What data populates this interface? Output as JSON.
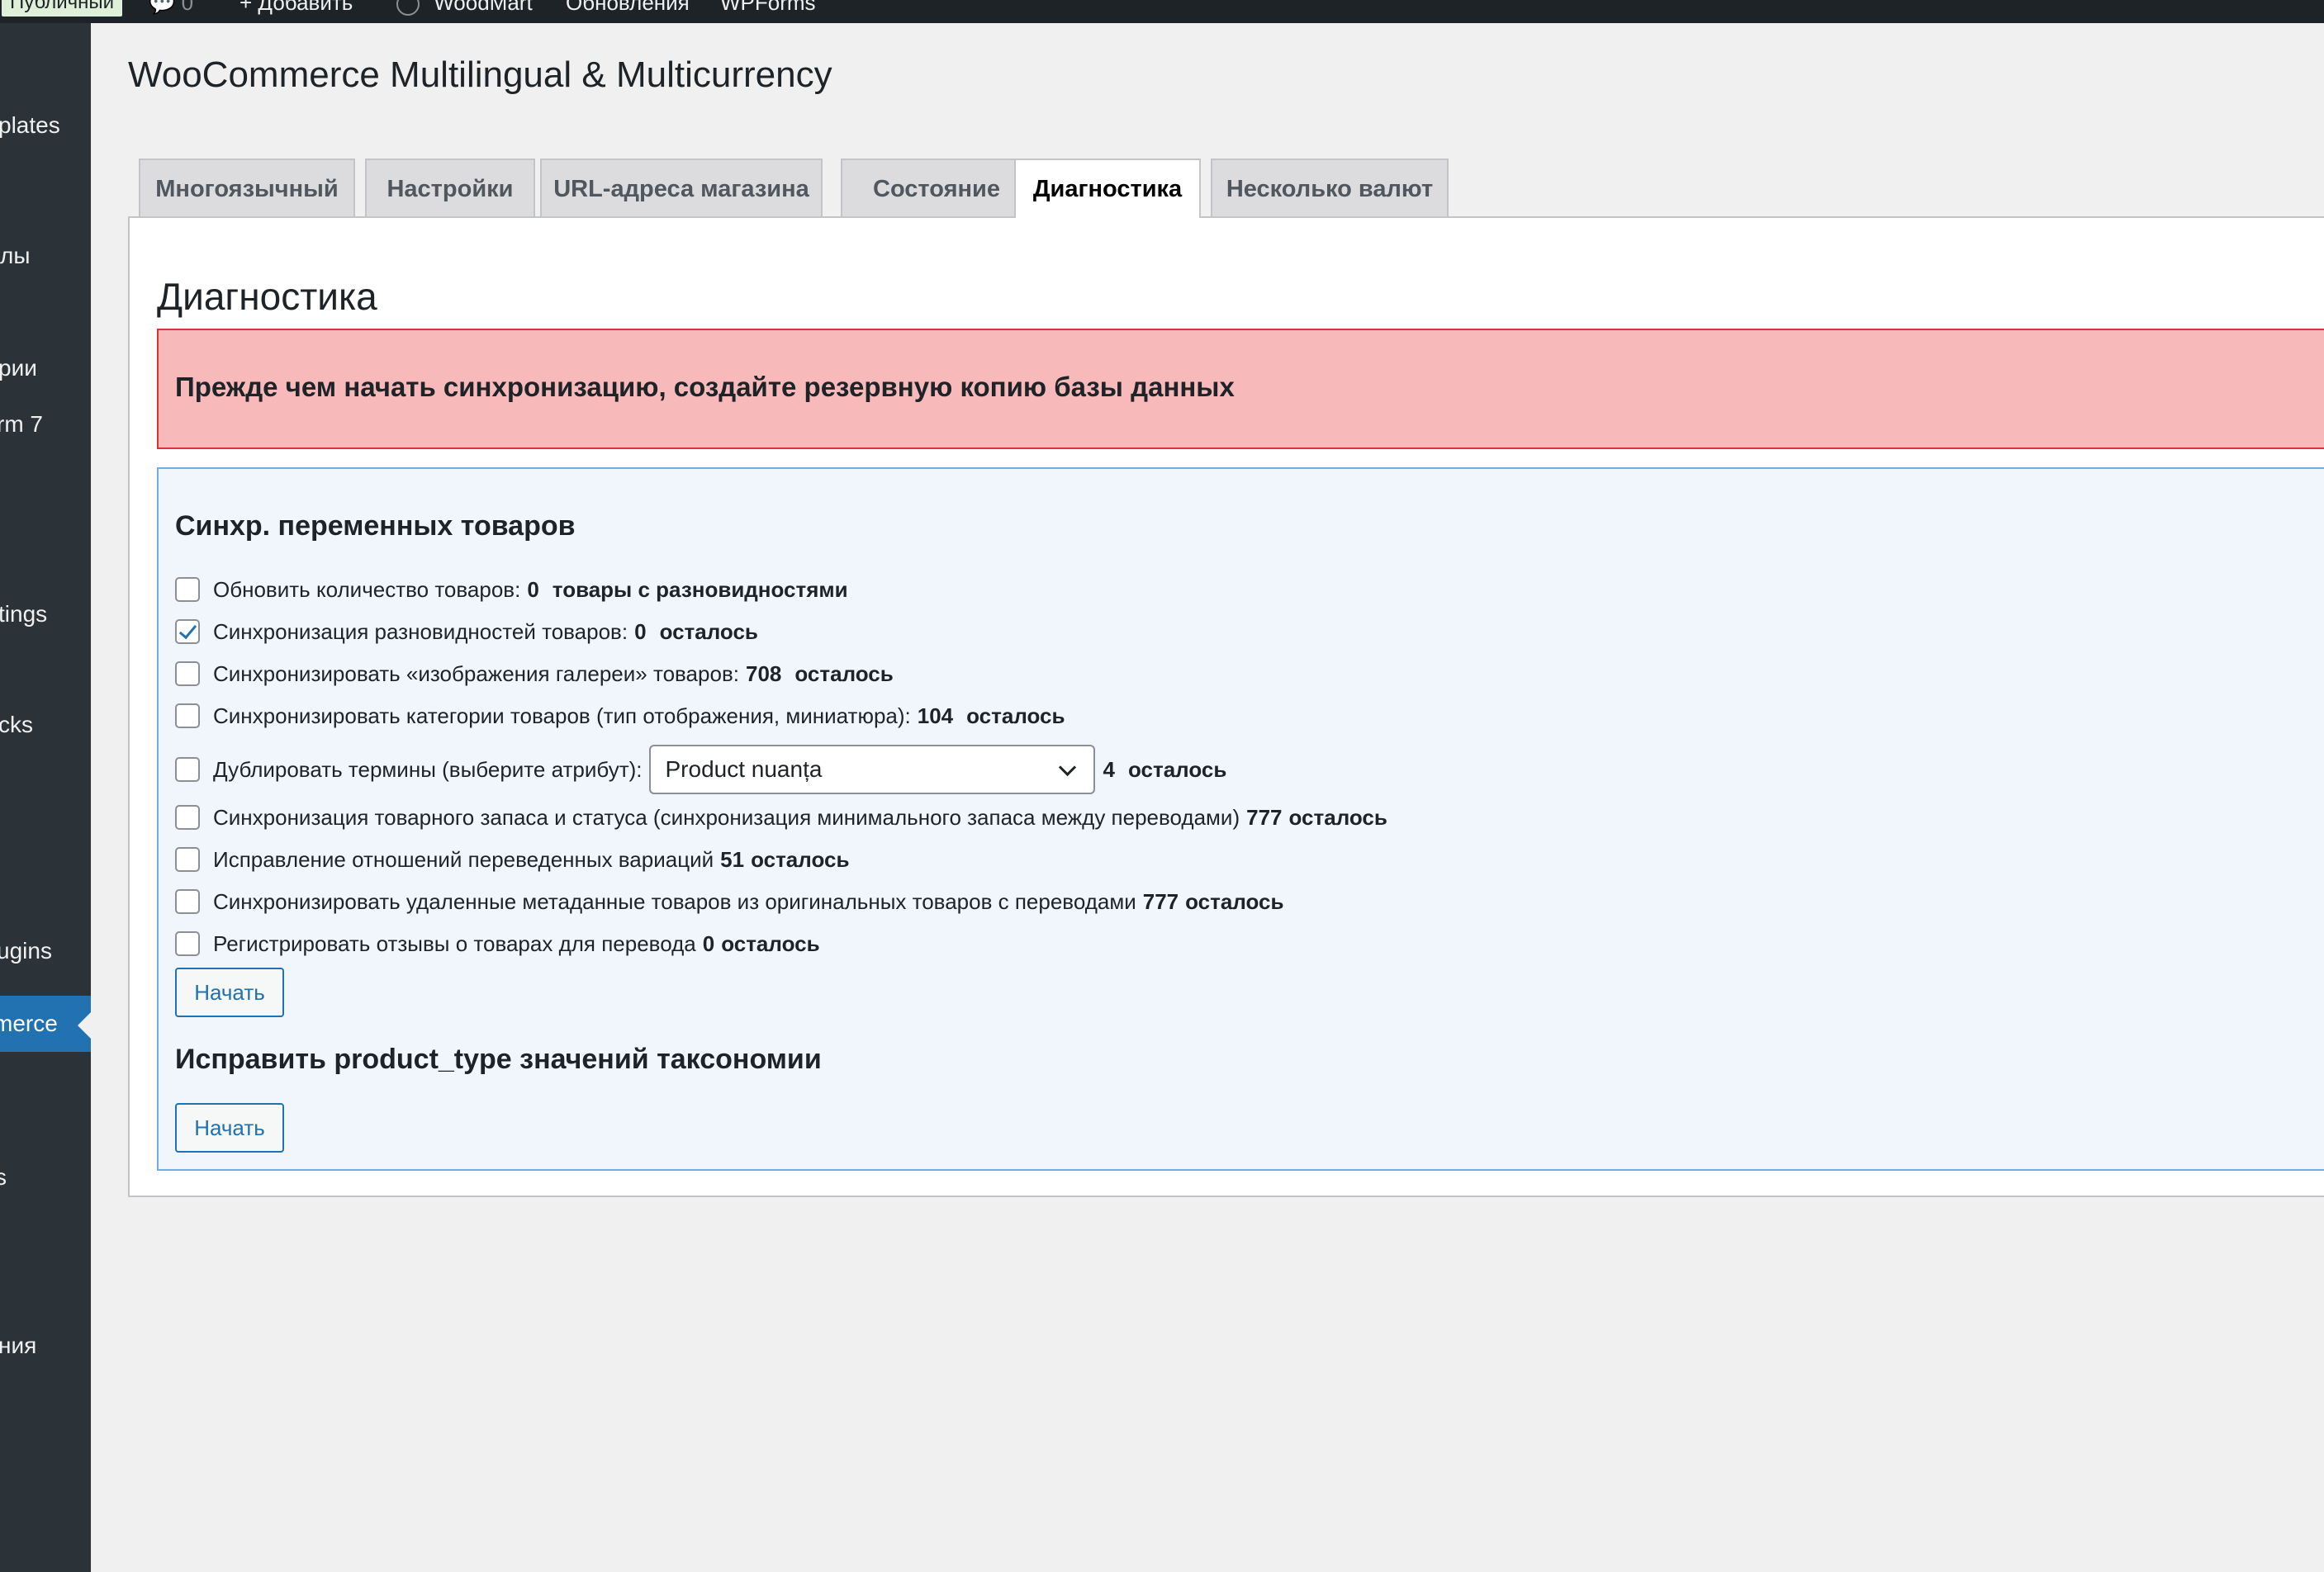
{
  "adminbar": {
    "badge": "Публичный",
    "comments_count": "0",
    "add_new": "Добавить",
    "woodmart": "WoodMart",
    "updates": "Обновления",
    "wpforms": "WPForms"
  },
  "sidebar": {
    "items": [
      {
        "label": "plates"
      },
      {
        "label": "лы"
      },
      {
        "label": "рии"
      },
      {
        "label": "rm 7"
      },
      {
        "label": "tings"
      },
      {
        "label": "cks"
      },
      {
        "label": "ugins"
      },
      {
        "label": "merce"
      },
      {
        "label": "s"
      },
      {
        "label": "ния"
      }
    ]
  },
  "page": {
    "title": "WooCommerce Multilingual & Multicurrency"
  },
  "tabs": [
    {
      "label": "Многоязычный"
    },
    {
      "label": "Настройки"
    },
    {
      "label": "URL-адреса магазина"
    },
    {
      "label": "Состояние"
    },
    {
      "label": "Диагностика"
    },
    {
      "label": "Несколько валют"
    }
  ],
  "active_tab": "Диагностика",
  "section": {
    "title": "Диагностика",
    "warning": "Прежде чем начать синхронизацию, создайте резервную копию базы данных"
  },
  "sync_variable": {
    "title": "Синхр. переменных товаров",
    "options": [
      {
        "label": "Обновить количество товаров:",
        "value": "0",
        "suffix": "товары с разновидностями",
        "checked": false
      },
      {
        "label": "Синхронизация разновидностей товаров:",
        "value": "0",
        "suffix": "осталось",
        "checked": true
      },
      {
        "label": "Синхронизировать «изображения галереи» товаров:",
        "value": "708",
        "suffix": "осталось",
        "checked": false
      },
      {
        "label": "Синхронизировать категории товаров (тип отображения, миниатюра):",
        "value": "104",
        "suffix": "осталось",
        "checked": false
      },
      {
        "label": "Дублировать термины (выберите атрибут):",
        "select_value": "Product nuanța",
        "value": "4",
        "suffix": "осталось",
        "checked": false
      },
      {
        "label": "Синхронизация товарного запаса и статуса (синхронизация минимального запаса между переводами)",
        "value": "777",
        "suffix": "осталось",
        "checked": false
      },
      {
        "label": "Исправление отношений переведенных вариаций",
        "value": "51",
        "suffix": "осталось",
        "checked": false
      },
      {
        "label": "Синхронизировать удаленные метаданные товаров из оригинальных товаров с переводами",
        "value": "777",
        "suffix": "осталось",
        "checked": false
      },
      {
        "label": "Регистрировать отзывы о товарах для перевода",
        "value": "0",
        "suffix": "осталось",
        "checked": false
      }
    ],
    "button": "Начать"
  },
  "fix_taxonomy": {
    "title": "Исправить product_type значений таксономии",
    "button": "Начать"
  }
}
